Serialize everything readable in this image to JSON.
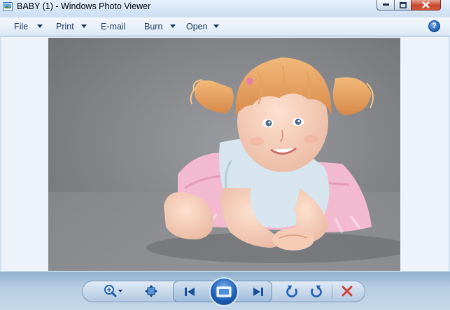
{
  "window": {
    "title": "BABY (1) - Windows Photo Viewer",
    "icon": "photo-viewer-icon"
  },
  "menu": {
    "items": [
      {
        "label": "File",
        "has_dropdown": true
      },
      {
        "label": "Print",
        "has_dropdown": true
      },
      {
        "label": "E-mail",
        "has_dropdown": false
      },
      {
        "label": "Burn",
        "has_dropdown": true
      },
      {
        "label": "Open",
        "has_dropdown": true
      }
    ],
    "help_icon": "help-icon",
    "help_label": "?"
  },
  "photo": {
    "subject": "photo-toddler-girl-lying-on-floor"
  },
  "controls": {
    "zoom_icon": "zoom-icon",
    "actual_size_icon": "actual-size-icon",
    "previous_icon": "previous-icon",
    "slideshow_icon": "slideshow-icon",
    "next_icon": "next-icon",
    "rotate_ccw_icon": "rotate-counterclockwise-icon",
    "rotate_cw_icon": "rotate-clockwise-icon",
    "delete_icon": "delete-icon"
  },
  "colors": {
    "accent": "#1f5fb8",
    "delete": "#d33a2c",
    "menu_text": "#1e395b"
  }
}
